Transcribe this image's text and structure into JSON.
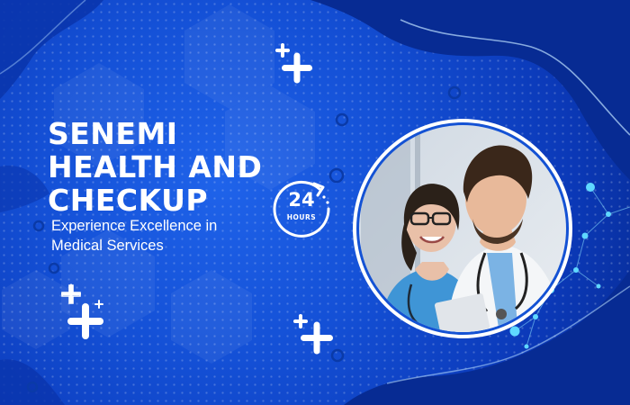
{
  "banner": {
    "title_lines": [
      "SENEMI",
      "HEALTH AND",
      "CHECKUP"
    ],
    "subtitle_lines": [
      "Experience Excellence in",
      "Medical Services"
    ],
    "badge": {
      "number": "24",
      "label": "HOURS",
      "icon": "clock-arrow-icon"
    },
    "photo": {
      "subject": "doctor and nurse reviewing a clipboard"
    },
    "colors": {
      "background": "#1450d6",
      "dark_wave": "#072b93",
      "text": "#ffffff",
      "accent_node": "#5fd8ff"
    },
    "icons": [
      "plus-icon",
      "clock-arrow-icon",
      "molecule-network-icon",
      "hexagon-pattern"
    ]
  }
}
